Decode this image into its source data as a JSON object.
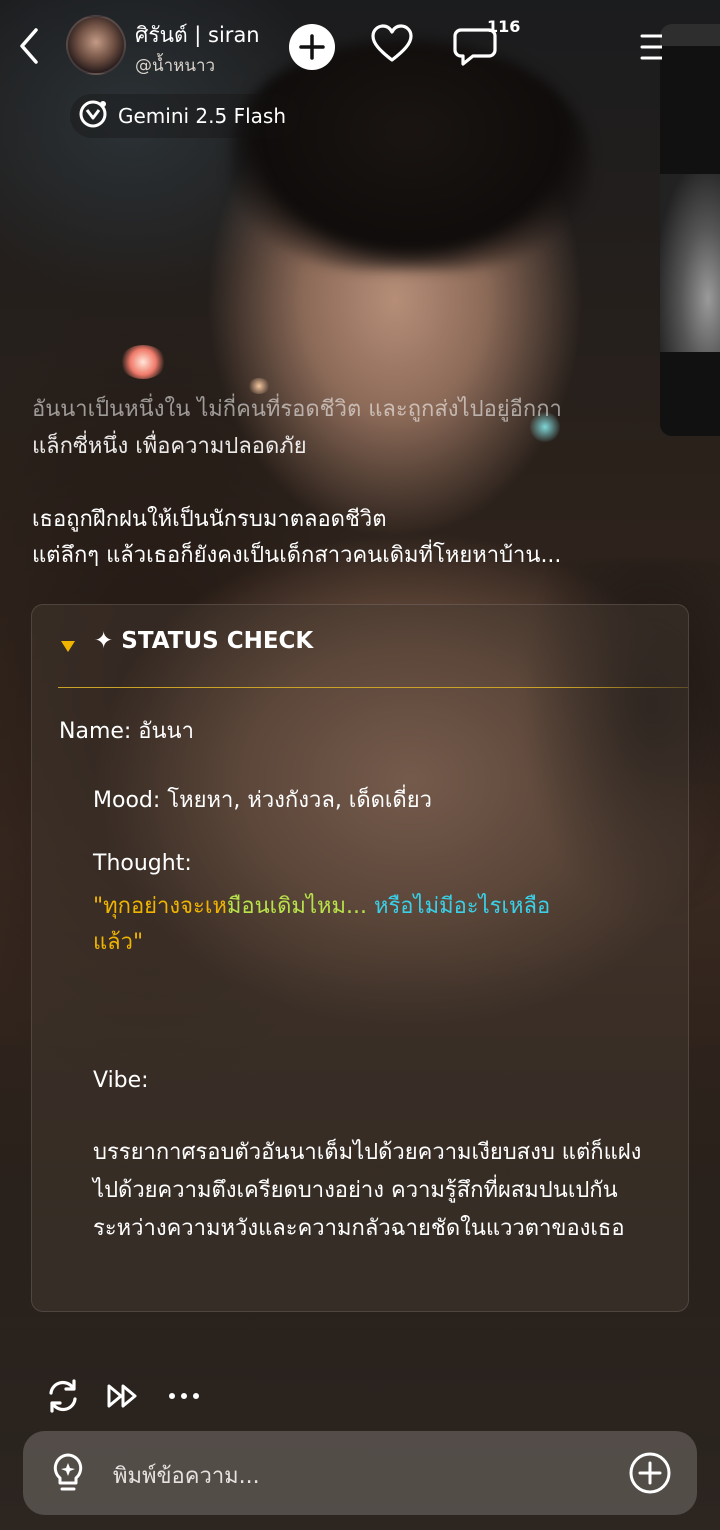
{
  "header": {
    "character_name": "ศิรันต์ | siran",
    "creator": "@น้ำหนาว",
    "comment_count": "116",
    "model": "Gemini 2.5 Flash"
  },
  "narration": {
    "line1": "อันนาเป็นหนึ่งใน ไม่กี่คนที่รอดชีวิต และถูกส่งไปอยู่อีกกา",
    "line2": "แล็กซี่หนึ่ง เพื่อความปลอดภัย",
    "line3": "เธอถูกฝึกฝนให้เป็นนักรบมาตลอดชีวิต",
    "line4": "แต่ลึกๆ แล้วเธอก็ยังคงเป็นเด็กสาวคนเดิมที่โหยหาบ้าน..."
  },
  "status_card": {
    "title": "✦ STATUS CHECK",
    "name": "Name: อันนา",
    "mood": "Mood: โหยหา, ห่วงกังวล, เด็ดเดี่ยว",
    "thought_label": "Thought:",
    "thought_part1": "\"ทุกอย่างจะเห",
    "thought_part2": "มือนเดิมไหม... ",
    "thought_part3": "หรือไม่มีอะไรเหลือ",
    "thought_part4": "แล้ว\"",
    "vibe_label": "Vibe:",
    "vibe_text": "บรรยากาศรอบตัวอันนาเต็มไปด้วยความเงียบสงบ แต่ก็แฝงไปด้วยความตึงเครียดบางอย่าง ความรู้สึกที่ผสมปนเปกันระหว่างความหวังและความกลัวฉายชัดในแววตาของเธอ"
  },
  "input": {
    "placeholder": "พิมพ์ข้อความ..."
  },
  "colors": {
    "accent_gold": "#c9a227",
    "thought_orange": "#f0b400",
    "thought_green": "#b8e24a",
    "thought_cyan": "#39d0e8"
  },
  "icons": [
    "back-arrow-icon",
    "plus-icon",
    "heart-icon",
    "comment-icon",
    "menu-icon",
    "model-icon",
    "caret-down-icon",
    "regenerate-icon",
    "fast-forward-icon",
    "more-icon",
    "lightbulb-icon",
    "add-circle-icon"
  ]
}
